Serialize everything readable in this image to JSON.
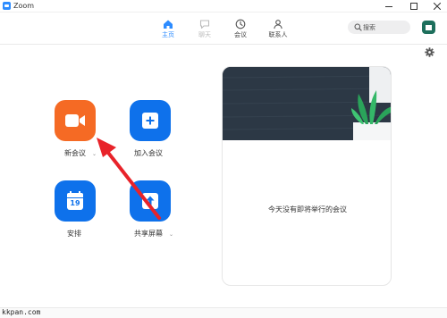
{
  "window": {
    "title": "Zoom"
  },
  "nav": {
    "tabs": [
      {
        "label": "主页"
      },
      {
        "label": "聊天"
      },
      {
        "label": "会议"
      },
      {
        "label": "联系人"
      }
    ],
    "search_placeholder": "搜索"
  },
  "actions": {
    "new_meeting": "新会议",
    "join": "加入会议",
    "schedule": "安排",
    "schedule_day": "19",
    "share_screen": "共享屏幕"
  },
  "meetings": {
    "empty_text": "今天没有即将举行的会议"
  },
  "footer": {
    "watermark": "kkpan.com"
  },
  "colors": {
    "accent": "#2D8CFF",
    "orange": "#F56A24",
    "blue": "#0E71EB",
    "arrow": "#E8232A"
  }
}
